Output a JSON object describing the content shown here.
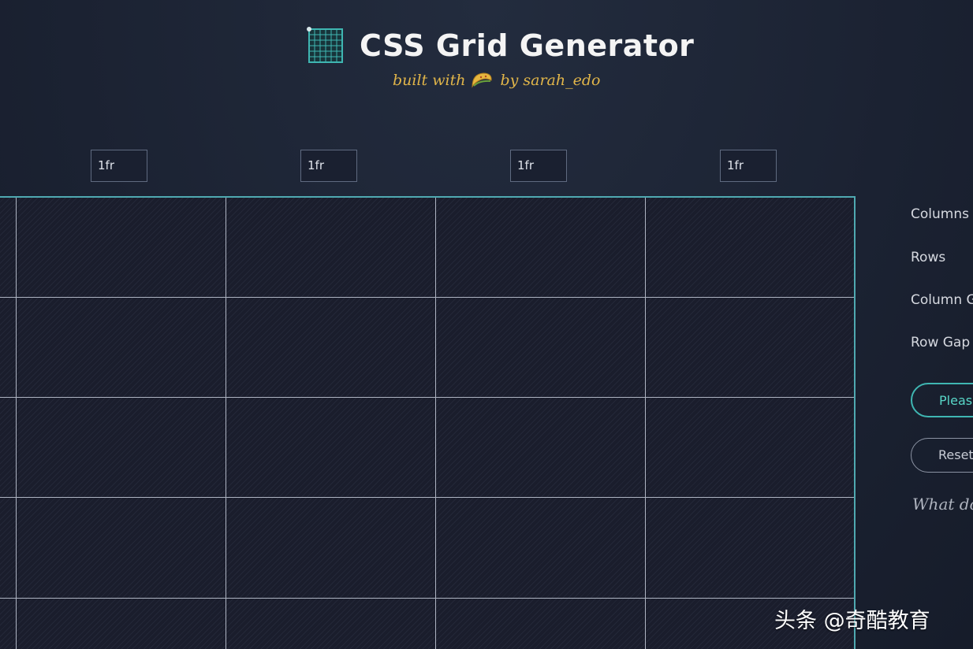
{
  "header": {
    "title": "CSS Grid Generator",
    "subtitle_prefix": "built with",
    "subtitle_suffix": "by sarah_edo",
    "icons": {
      "logo": "grid-logo-icon",
      "taco": "taco-icon"
    }
  },
  "column_inputs": [
    "1fr",
    "1fr",
    "1fr",
    "1fr"
  ],
  "grid": {
    "columns_visible": 4,
    "rows_visible": 5
  },
  "controls": {
    "columns_label": "Columns",
    "rows_label": "Rows",
    "column_gap_label": "Column G",
    "row_gap_label": "Row Gap (",
    "primary_button": "Please",
    "secondary_button": "Reset",
    "help_link": "What do"
  },
  "watermark": "头条 @奇酷教育",
  "colors": {
    "background": "#1b2232",
    "grid_border": "#4fa9b1",
    "accent": "#58d6c7",
    "subtitle": "#e1b549"
  }
}
